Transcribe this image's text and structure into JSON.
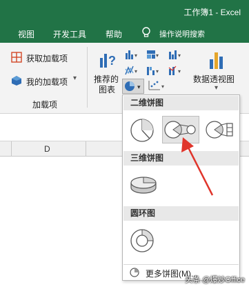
{
  "window": {
    "title": "工作簿1 - Excel"
  },
  "menu": {
    "view": "视图",
    "developer": "开发工具",
    "help": "帮助",
    "tell_me": "操作说明搜索",
    "bulb_icon": "lightbulb-icon"
  },
  "ribbon": {
    "get_addins": "获取加载项",
    "my_addins": "我的加载项",
    "addins_group": "加载项",
    "recommended_line1": "推荐的",
    "recommended_line2": "图表",
    "pivot_chart": "数据透视图"
  },
  "grid": {
    "column_d": "D"
  },
  "dropdown": {
    "section_2d": "二维饼图",
    "section_3d": "三维饼图",
    "section_donut": "圆环图",
    "more": "更多饼图(M)..."
  },
  "watermark": "头条 @爆炒Office",
  "colors": {
    "excel_green": "#217346",
    "accent_red": "#e0352b",
    "chart_blue": "#2f6db5"
  }
}
